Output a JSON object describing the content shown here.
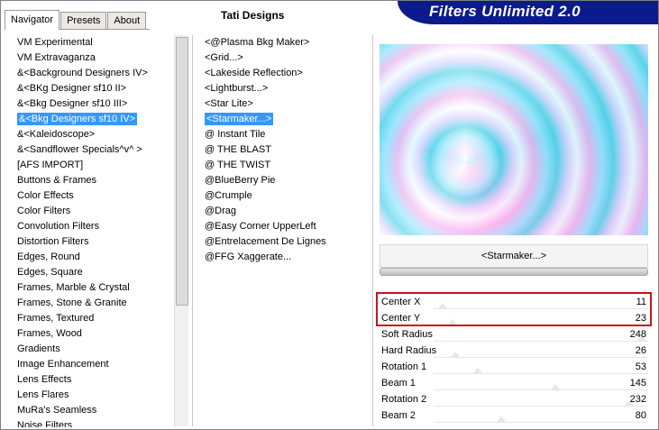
{
  "tabs": [
    {
      "label": "Navigator",
      "active": true
    },
    {
      "label": "Presets",
      "active": false
    },
    {
      "label": "About",
      "active": false
    }
  ],
  "set_title": "Tati Designs",
  "banner": "Filters Unlimited 2.0",
  "categories": [
    "VM Experimental",
    "VM Extravaganza",
    "&<Background Designers IV>",
    "&<BKg Designer sf10 II>",
    "&<Bkg Designer sf10 III>",
    "&<Bkg Designers sf10 IV>",
    "&<Kaleidoscope>",
    "&<Sandflower Specials^v^ >",
    "[AFS IMPORT]",
    "Buttons & Frames",
    "Color Effects",
    "Color Filters",
    "Convolution Filters",
    "Distortion Filters",
    "Edges, Round",
    "Edges, Square",
    "Frames, Marble & Crystal",
    "Frames, Stone & Granite",
    "Frames, Textured",
    "Frames, Wood",
    "Gradients",
    "Image Enhancement",
    "Lens Effects",
    "Lens Flares",
    "MuRa's Seamless",
    "Noise Filters"
  ],
  "selected_category_index": 5,
  "filters": [
    "<@Plasma Bkg Maker>",
    "<Grid...>",
    "<Lakeside Reflection>",
    "<Lightburst...>",
    "<Star Lite>",
    "<Starmaker...>",
    "@ Instant Tile",
    "@ THE BLAST",
    "@ THE TWIST",
    "@BlueBerry Pie",
    "@Crumple",
    "@Drag",
    "@Easy Corner UpperLeft",
    "@Entrelacement De Lignes",
    "@FFG Xaggerate..."
  ],
  "selected_filter_index": 5,
  "filter_name": "<Starmaker...>",
  "params": [
    {
      "label": "Center X",
      "value": "11",
      "level": 11
    },
    {
      "label": "Center Y",
      "value": "23",
      "level": 23
    },
    {
      "label": "Soft Radius",
      "value": "248",
      "level": 248
    },
    {
      "label": "Hard Radius",
      "value": "26",
      "level": 26
    },
    {
      "label": "Rotation 1",
      "value": "53",
      "level": 53
    },
    {
      "label": "Beam 1",
      "value": "145",
      "level": 145
    },
    {
      "label": "Rotation 2",
      "value": "232",
      "level": 232
    },
    {
      "label": "Beam 2",
      "value": "80",
      "level": 80
    }
  ],
  "param_max": 255,
  "colors": {
    "banner": "#0b1a8c",
    "selection": "#3399ff",
    "highlight": "#c8141e"
  }
}
